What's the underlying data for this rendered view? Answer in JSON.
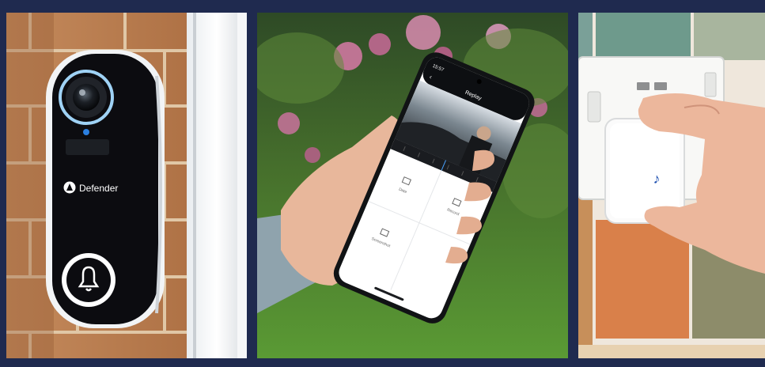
{
  "colors": {
    "frame": "#1f2a4f",
    "doorbell_body": "#0c0c10",
    "doorbell_shell": "#f1f3f5",
    "ring_accent": "#9fd2f5",
    "brick": "#b9784a",
    "grass": "#4f8a2e",
    "flowers": "#d77aa6",
    "tile_orange": "#d9804a",
    "tile_green": "#6e9a8c",
    "chime_note": "#1d4fb0"
  },
  "icons": [
    "doorbell-camera-icon",
    "bell-icon",
    "defender-logo-icon",
    "music-note-icon",
    "usb-port-icon",
    "back-arrow-icon",
    "camera-icon",
    "record-icon",
    "screenshot-icon"
  ],
  "panels": {
    "doorbell": {
      "brand": "Defender"
    },
    "phone": {
      "status_time": "15:57",
      "screen_title": "Replay",
      "grid_labels": [
        "Date",
        "Record",
        "Screenshot"
      ]
    },
    "chime": {}
  }
}
